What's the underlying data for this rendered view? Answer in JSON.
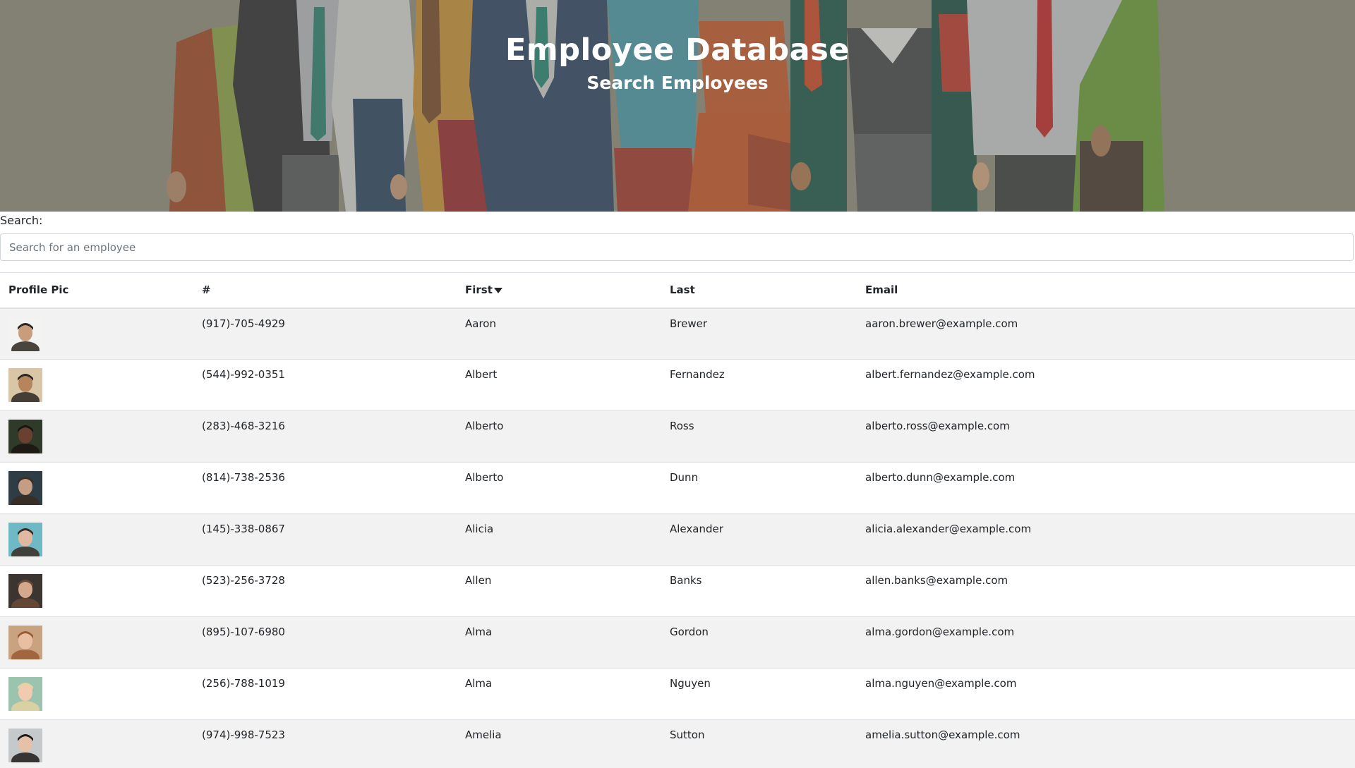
{
  "header": {
    "title": "Employee Database",
    "subtitle": "Search Employees"
  },
  "search": {
    "label": "Search:",
    "placeholder": "Search for an employee",
    "value": ""
  },
  "table": {
    "columns": [
      "Profile Pic",
      "#",
      "First",
      "Last",
      "Email"
    ],
    "sorted_column": "First",
    "sort_direction": "descending-arrow",
    "rows": [
      {
        "phone": "(917)-705-4929",
        "first": "Aaron",
        "last": "Brewer",
        "email": "aaron.brewer@example.com"
      },
      {
        "phone": "(544)-992-0351",
        "first": "Albert",
        "last": "Fernandez",
        "email": "albert.fernandez@example.com"
      },
      {
        "phone": "(283)-468-3216",
        "first": "Alberto",
        "last": "Ross",
        "email": "alberto.ross@example.com"
      },
      {
        "phone": "(814)-738-2536",
        "first": "Alberto",
        "last": "Dunn",
        "email": "alberto.dunn@example.com"
      },
      {
        "phone": "(145)-338-0867",
        "first": "Alicia",
        "last": "Alexander",
        "email": "alicia.alexander@example.com"
      },
      {
        "phone": "(523)-256-3728",
        "first": "Allen",
        "last": "Banks",
        "email": "allen.banks@example.com"
      },
      {
        "phone": "(895)-107-6980",
        "first": "Alma",
        "last": "Gordon",
        "email": "alma.gordon@example.com"
      },
      {
        "phone": "(256)-788-1019",
        "first": "Alma",
        "last": "Nguyen",
        "email": "alma.nguyen@example.com"
      },
      {
        "phone": "(974)-998-7523",
        "first": "Amelia",
        "last": "Sutton",
        "email": "amelia.sutton@example.com"
      }
    ]
  },
  "colors": {
    "banner_overlay": "#8f8c7f",
    "striped_row": "#f2f2f2",
    "border": "#dee2e6",
    "text": "#212529"
  }
}
